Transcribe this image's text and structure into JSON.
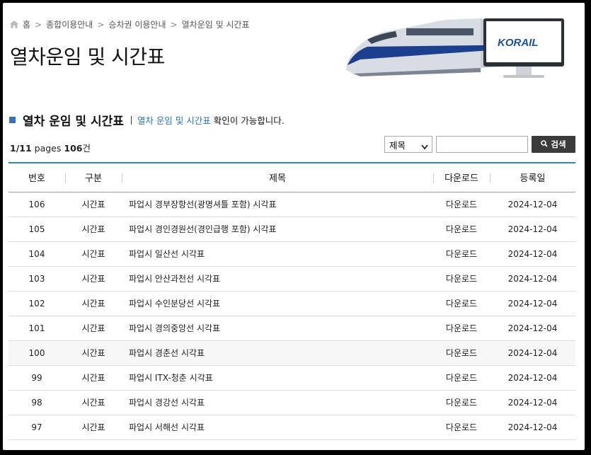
{
  "breadcrumb": [
    "홈",
    "종합이용안내",
    "승차권 이용안내",
    "열차운임 및 시간표"
  ],
  "page_title": "열차운임 및 시간표",
  "brand": "KORAIL",
  "section": {
    "title": "열차 운임 및 시간표",
    "desc_link": "열차 운임 및 시간표",
    "desc_rest": " 확인이 가능합니다."
  },
  "count": {
    "page": "1/11",
    "pages_label": "pages",
    "total": "106",
    "unit": "건"
  },
  "search": {
    "select_value": "제목",
    "button_label": "검색",
    "input_value": ""
  },
  "table": {
    "headers": [
      "번호",
      "구분",
      "제목",
      "다운로드",
      "등록일"
    ],
    "rows": [
      {
        "no": "106",
        "cat": "시간표",
        "title": "파업시 경부장항선(광명셔틀 포함) 시각표",
        "dl": "다운로드",
        "date": "2024-12-04"
      },
      {
        "no": "105",
        "cat": "시간표",
        "title": "파업시 경인경원선(경인급행 포함) 시각표",
        "dl": "다운로드",
        "date": "2024-12-04"
      },
      {
        "no": "104",
        "cat": "시간표",
        "title": "파업시 일산선 시각표",
        "dl": "다운로드",
        "date": "2024-12-04"
      },
      {
        "no": "103",
        "cat": "시간표",
        "title": "파업시 안산과천선 시각표",
        "dl": "다운로드",
        "date": "2024-12-04"
      },
      {
        "no": "102",
        "cat": "시간표",
        "title": "파업시 수인분당선 시각표",
        "dl": "다운로드",
        "date": "2024-12-04"
      },
      {
        "no": "101",
        "cat": "시간표",
        "title": "파업시 경의중앙선 시각표",
        "dl": "다운로드",
        "date": "2024-12-04"
      },
      {
        "no": "100",
        "cat": "시간표",
        "title": "파업시 경춘선 시각표",
        "dl": "다운로드",
        "date": "2024-12-04"
      },
      {
        "no": "99",
        "cat": "시간표",
        "title": "파업시 ITX-청춘 시각표",
        "dl": "다운로드",
        "date": "2024-12-04"
      },
      {
        "no": "98",
        "cat": "시간표",
        "title": "파업시 경강선 시각표",
        "dl": "다운로드",
        "date": "2024-12-04"
      },
      {
        "no": "97",
        "cat": "시간표",
        "title": "파업시 서해선 시각표",
        "dl": "다운로드",
        "date": "2024-12-04"
      }
    ]
  },
  "colors": {
    "accent": "#2f86c7",
    "link": "#2a74c3",
    "button": "#3b3b3b"
  }
}
